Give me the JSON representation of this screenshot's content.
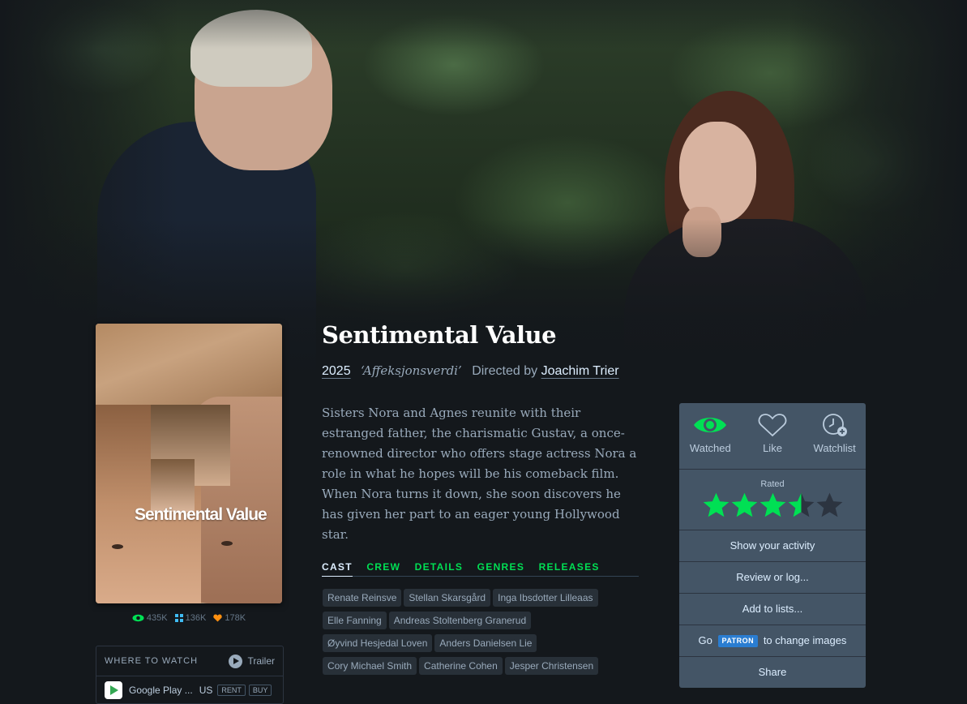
{
  "film": {
    "title": "Sentimental Value",
    "year": "2025",
    "original_title": "‘Affeksjonsverdi’",
    "directed_by_label": "Directed by",
    "director": "Joachim Trier",
    "synopsis": "Sisters Nora and Agnes reunite with their estranged father, the charismatic Gustav, a once-renowned director who offers stage actress Nora a role in what he hopes will be his comeback film. When Nora turns it down, she soon discovers he has given her part to an eager young Hollywood star.",
    "poster_title": "Sentimental Value"
  },
  "stats": {
    "watched": "435K",
    "lists": "136K",
    "likes": "178K"
  },
  "where_to_watch": {
    "label": "WHERE TO WATCH",
    "trailer_label": "Trailer",
    "provider": "Google Play ...",
    "region": "US",
    "rent_label": "RENT",
    "buy_label": "BUY"
  },
  "tabs": [
    {
      "label": "CAST"
    },
    {
      "label": "CREW"
    },
    {
      "label": "DETAILS"
    },
    {
      "label": "GENRES"
    },
    {
      "label": "RELEASES"
    }
  ],
  "cast": [
    "Renate Reinsve",
    "Stellan Skarsgård",
    "Inga Ibsdotter Lilleaas",
    "Elle Fanning",
    "Andreas Stoltenberg Granerud",
    "Øyvind Hesjedal Loven",
    "Anders Danielsen Lie",
    "Cory Michael Smith",
    "Catherine Cohen",
    "Jesper Christensen"
  ],
  "panel": {
    "watched_label": "Watched",
    "like_label": "Like",
    "watchlist_label": "Watchlist",
    "rated_label": "Rated",
    "rating": 3.5,
    "rating_max": 5,
    "show_activity": "Show your activity",
    "review": "Review or log...",
    "add_lists": "Add to lists...",
    "go_label": "Go",
    "patron_label": "PATRON",
    "change_images": "to change images",
    "share": "Share"
  },
  "colors": {
    "accent_green": "#00e054",
    "star_empty": "#2c3440",
    "like_orange": "#ff9010",
    "list_blue": "#40bcf4",
    "panel_bg": "#445566"
  },
  "icons": {
    "watched": "eye-icon",
    "like": "heart-icon",
    "watchlist": "clock-plus-icon",
    "trailer": "play-icon",
    "provider": "google-play-icon"
  }
}
